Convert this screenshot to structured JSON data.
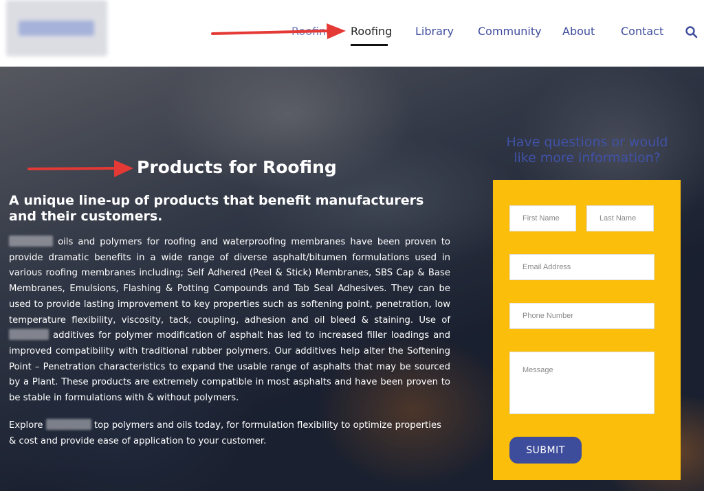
{
  "header": {
    "nav": [
      {
        "label": "Roofing",
        "active": true
      },
      {
        "label": "Library",
        "active": false
      },
      {
        "label": "Community",
        "active": false
      },
      {
        "label": "About",
        "active": false
      },
      {
        "label": "Contact",
        "active": false
      }
    ],
    "nav_hidden_label": "Roofing",
    "search_icon": "search-icon"
  },
  "hero": {
    "title": "Products for Roofing",
    "subtitle": "A unique line-up of products that benefit manufacturers and their customers.",
    "paragraph_1_a": "oils and polymers for roofing and waterproofing membranes have been proven to provide dramatic benefits in a wide range of diverse asphalt/bitumen formulations used in various roofing membranes including; Self Adhered (Peel & Stick) Membranes, SBS Cap & Base Membranes, Emulsions, Flashing & Potting Compounds and Tab Seal Adhesives. They can be used to provide lasting improvement to key properties such as softening point, penetration, low temperature flexibility, viscosity, tack, coupling, adhesion and oil bleed & staining. Use of",
    "paragraph_1_b": "additives for polymer modification of asphalt has led to increased filler loadings and improved compatibility with traditional rubber polymers. Our additives help alter the Softening Point – Penetration characteristics to expand the usable range of asphalts that may be sourced by a Plant. These products are extremely compatible in most asphalts and have been proven to be stable in formulations with & without polymers.",
    "paragraph_2_a": "Explore",
    "paragraph_2_b": "top polymers and oils today, for formulation flexibility to optimize properties & cost and provide ease of application to your customer."
  },
  "contact": {
    "question": "Have questions or would like more information?",
    "first_name_placeholder": "First Name",
    "last_name_placeholder": "Last Name",
    "email_placeholder": "Email Address",
    "phone_placeholder": "Phone Number",
    "message_placeholder": "Message",
    "submit_label": "SUBMIT"
  },
  "colors": {
    "nav": "#3e4c9c",
    "accent_yellow": "#fbbe0b",
    "arrow_red": "#e53935"
  }
}
